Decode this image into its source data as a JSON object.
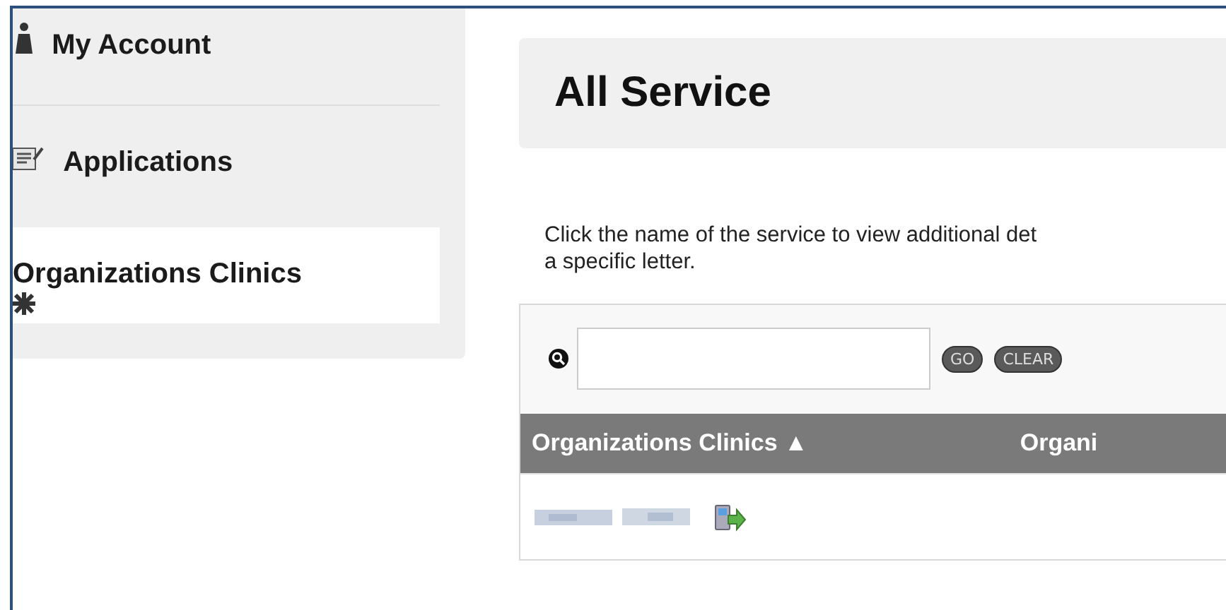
{
  "sidebar": {
    "items": [
      {
        "label": "My Account",
        "kind": "account",
        "selected": false
      },
      {
        "label": "Applications",
        "kind": "applications",
        "selected": false
      },
      {
        "label": "Organizations Clinics",
        "kind": "clinics",
        "selected": true
      }
    ]
  },
  "page": {
    "title": "All Service",
    "intro_lines": [
      "Click the name of the service to view additional det",
      "a specific letter."
    ]
  },
  "search": {
    "buttons": [
      "GO",
      "CLEAR"
    ]
  },
  "table": {
    "columns": [
      {
        "label": "Organizations Clinics",
        "sort_glyph": "▲"
      },
      {
        "label": "Organi"
      }
    ]
  }
}
